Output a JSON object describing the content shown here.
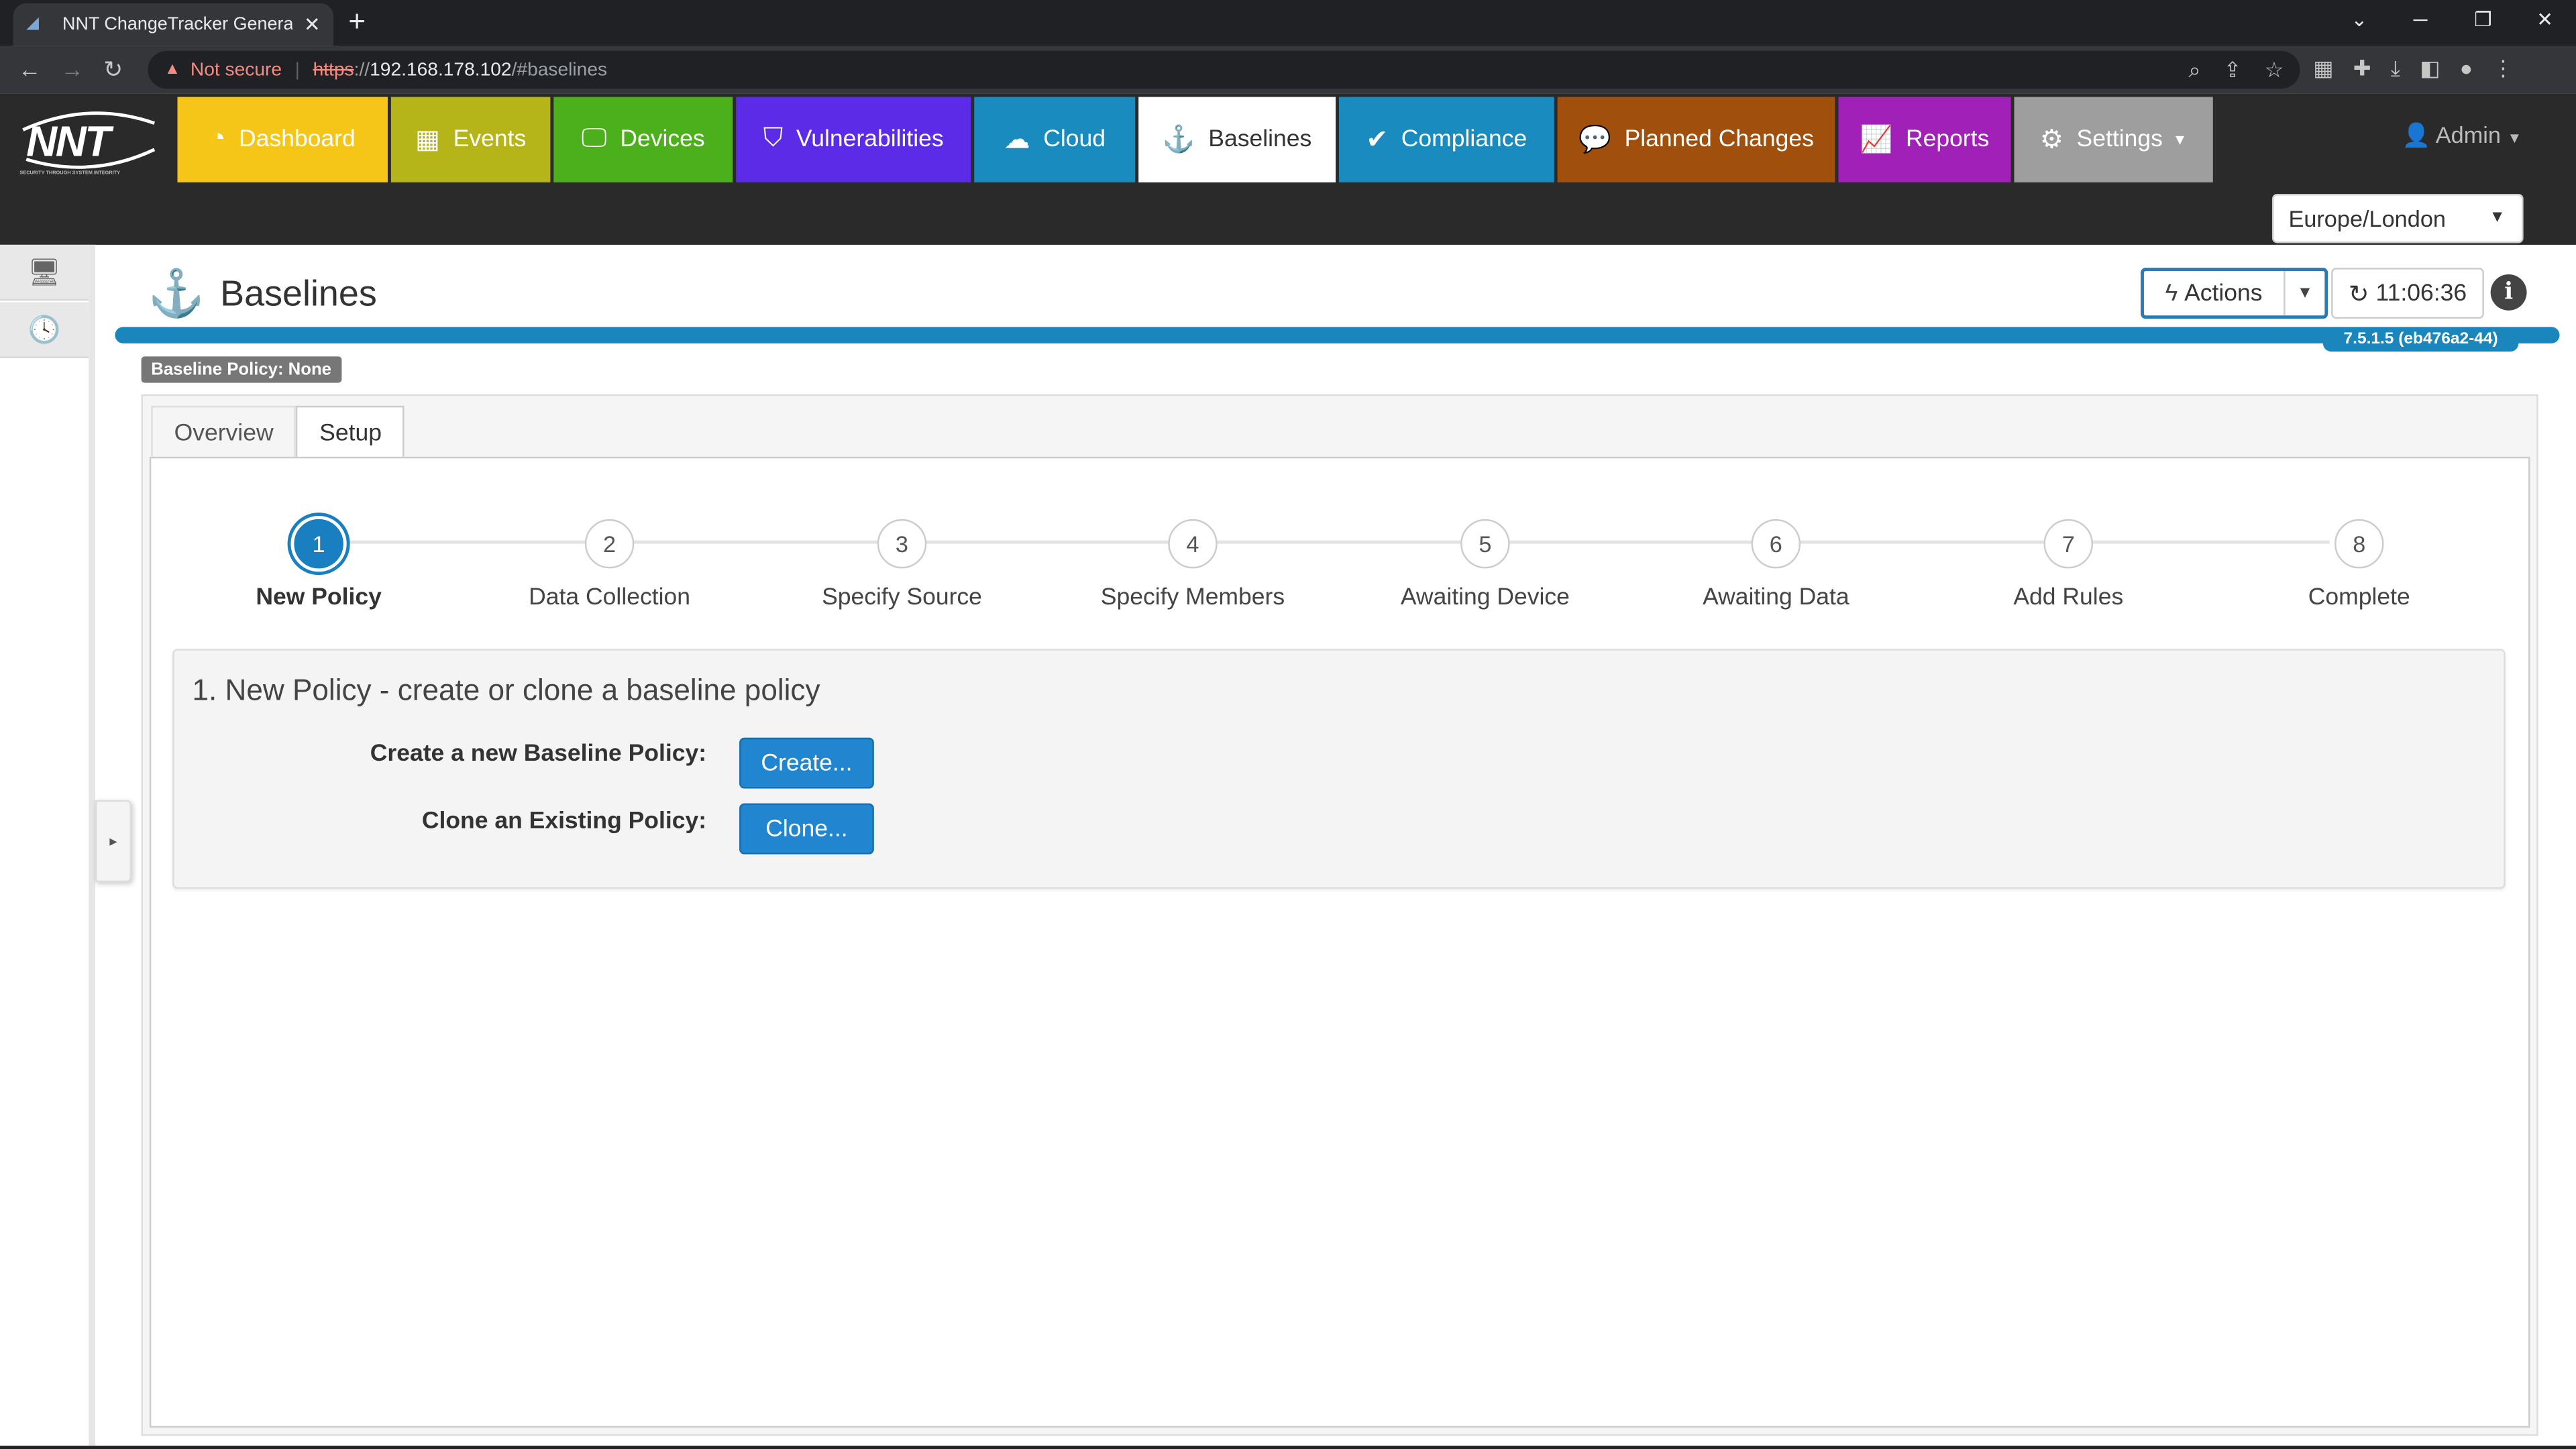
{
  "browser": {
    "tab_title": "NNT ChangeTracker Generation",
    "tab_close": "✕",
    "new_tab": "+",
    "not_secure": "Not secure",
    "url_scheme": "https",
    "url_sep": "://",
    "url_host": "192.168.178.102",
    "url_path": "/#baselines"
  },
  "header": {
    "logo_text": "NNT",
    "logo_tagline": "SECURITY THROUGH SYSTEM INTEGRITY",
    "nav": [
      {
        "label": "Dashboard",
        "color": "#f5c518",
        "icon": "dashboard-icon"
      },
      {
        "label": "Events",
        "color": "#b5b51a",
        "icon": "calendar-icon"
      },
      {
        "label": "Devices",
        "color": "#4caf1c",
        "icon": "monitor-icon"
      },
      {
        "label": "Vulnerabilities",
        "color": "#5b2be8",
        "icon": "shield-icon"
      },
      {
        "label": "Cloud",
        "color": "#1a8bbf",
        "icon": "cloud-icon"
      },
      {
        "label": "Baselines",
        "color": "#ffffff",
        "icon": "anchor-icon"
      },
      {
        "label": "Compliance",
        "color": "#1a8bbf",
        "icon": "check-icon"
      },
      {
        "label": "Planned Changes",
        "color": "#a04f0c",
        "icon": "speech-bubble-icon"
      },
      {
        "label": "Reports",
        "color": "#a020b8",
        "icon": "chart-icon"
      },
      {
        "label": "Settings",
        "color": "#9e9e9e",
        "icon": "gear-icon"
      }
    ],
    "user": "Admin",
    "timezone": "Europe/London"
  },
  "page": {
    "title": "Baselines",
    "actions_label": "Actions",
    "refresh_time": "11:06:36",
    "version": "7.5.1.5 (eb476a2-44)",
    "policy_badge": "Baseline Policy: None",
    "tabs": [
      "Overview",
      "Setup"
    ],
    "active_tab": "Setup"
  },
  "wizard": {
    "steps": [
      {
        "num": "1",
        "label": "New Policy"
      },
      {
        "num": "2",
        "label": "Data Collection"
      },
      {
        "num": "3",
        "label": "Specify Source"
      },
      {
        "num": "4",
        "label": "Specify Members"
      },
      {
        "num": "5",
        "label": "Awaiting Device"
      },
      {
        "num": "6",
        "label": "Awaiting Data"
      },
      {
        "num": "7",
        "label": "Add Rules"
      },
      {
        "num": "8",
        "label": "Complete"
      }
    ],
    "active_step": 1,
    "heading": "1. New Policy - create or clone a baseline policy",
    "create_label": "Create a new Baseline Policy:",
    "create_button": "Create...",
    "clone_label": "Clone an Existing Policy:",
    "clone_button": "Clone..."
  }
}
